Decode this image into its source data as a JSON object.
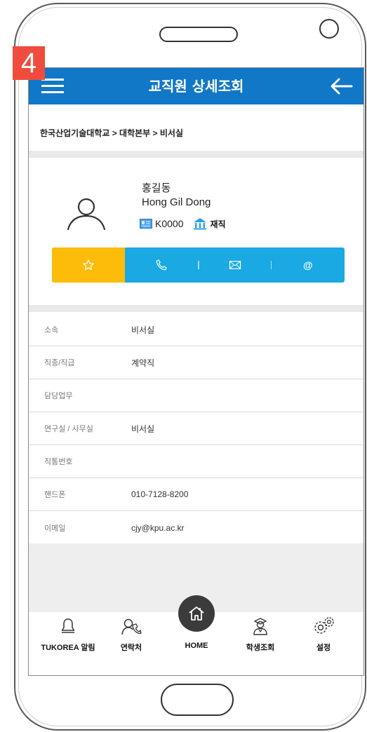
{
  "step_badge": "4",
  "header": {
    "title": "교직원 상세조회"
  },
  "breadcrumb": "한국산업기술대학교 > 대학본부 > 비서실",
  "profile": {
    "name_ko": "홍길동",
    "name_en": "Hong Gil Dong",
    "employee_id": "K0000",
    "status": "재직"
  },
  "actions": [
    {
      "icon": "star-icon",
      "label": ""
    },
    {
      "icon": "phone-icon",
      "label": ""
    },
    {
      "icon": "mail-icon",
      "label": ""
    },
    {
      "icon": "at-icon",
      "label": "@"
    }
  ],
  "info": [
    {
      "label": "소속",
      "value": "비서실"
    },
    {
      "label": "직종/직급",
      "value": "계약직"
    },
    {
      "label": "담당업무",
      "value": ""
    },
    {
      "label": "연구실 / 사무실",
      "value": "비서실"
    },
    {
      "label": "직통번호",
      "value": ""
    },
    {
      "label": "핸드폰",
      "value": "010-7128-8200"
    },
    {
      "label": "이메일",
      "value": "cjy@kpu.ac.kr"
    }
  ],
  "bottom_nav": [
    {
      "label": "TUKOREA 알림",
      "icon": "bell-icon"
    },
    {
      "label": "연락처",
      "icon": "contacts-icon"
    },
    {
      "label": "HOME",
      "icon": "home-icon"
    },
    {
      "label": "학생조회",
      "icon": "student-icon"
    },
    {
      "label": "설정",
      "icon": "gear-icon"
    }
  ],
  "colors": {
    "appbar": "#1177c7",
    "favorite": "#fdbb0a",
    "action_bar": "#1aa9e3",
    "badge": "#ef4c3d"
  }
}
